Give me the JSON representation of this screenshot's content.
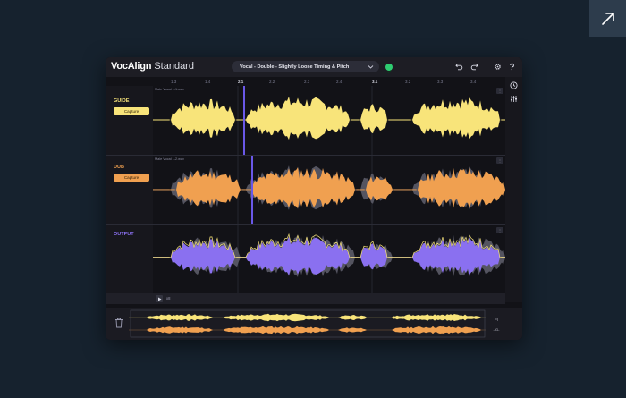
{
  "app": {
    "brand_bold": "VocAlign",
    "brand_light": " Standard",
    "preset": "Vocal - Double - Slightly Loose Timing & Pitch"
  },
  "icons": {
    "expand": "external-link-arrow-icon",
    "status": "check-circle-icon",
    "undo": "undo-icon",
    "redo": "redo-icon",
    "settings": "gear-icon",
    "help": "question-icon",
    "history": "clock-icon",
    "mixer": "sliders-icon",
    "trash": "trash-icon",
    "play": "play-icon"
  },
  "ruler": {
    "marks": [
      "1.3",
      "1.4",
      "2.1",
      "2.2",
      "2.3",
      "2.4",
      "3.1",
      "3.2",
      "3.3",
      "3.4"
    ],
    "bar_marks": [
      "2.1",
      "3.1"
    ]
  },
  "tracks": {
    "guide": {
      "label": "GUIDE",
      "capture": "Capture",
      "file": "Male Vocal 1-1.wav",
      "color": "#f8e47a"
    },
    "dub": {
      "label": "DUB",
      "capture": "Capture",
      "file": "Male Vocal 1-2.wav",
      "color": "#f0a050"
    },
    "output": {
      "label": "OUTPUT",
      "color": "#8a70f0",
      "outline": "#f8e47a"
    }
  },
  "transport": {
    "position": "x8"
  },
  "overview": {
    "btn_top": "▷|",
    "btn_bottom": "-/G-"
  },
  "colors": {
    "background": "#16222e",
    "panel": "#121217",
    "playhead": "#6a58e8",
    "guide": "#f8e47a",
    "dub": "#f0a050",
    "output": "#8a70f0"
  }
}
